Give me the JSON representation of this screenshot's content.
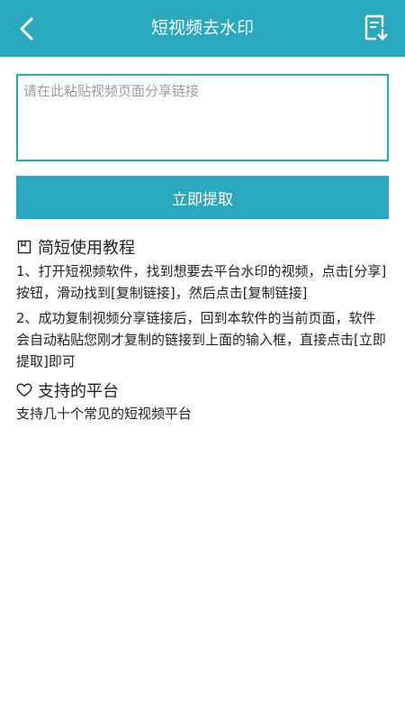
{
  "header": {
    "title": "短视频去水印",
    "back_icon": "chevron-left-icon",
    "action_icon": "document-download-icon",
    "color": "#2aa8bd"
  },
  "input": {
    "placeholder": "请在此粘贴视频页面分享链接",
    "value": ""
  },
  "extract_button": {
    "label": "立即提取"
  },
  "tutorial": {
    "icon": "bookmark-icon",
    "title": "简短使用教程",
    "steps": [
      "1、打开短视频软件，找到想要去平台水印的视频，点击[分享]按钮，滑动找到[复制链接]，然后点击[复制链接]",
      "2、成功复制视频分享链接后，回到本软件的当前页面，软件会自动粘贴您刚才复制的链接到上面的输入框，直接点击[立即提取]即可"
    ]
  },
  "platforms": {
    "icon": "heart-icon",
    "title": "支持的平台",
    "text": "支持几十个常见的短视频平台"
  }
}
